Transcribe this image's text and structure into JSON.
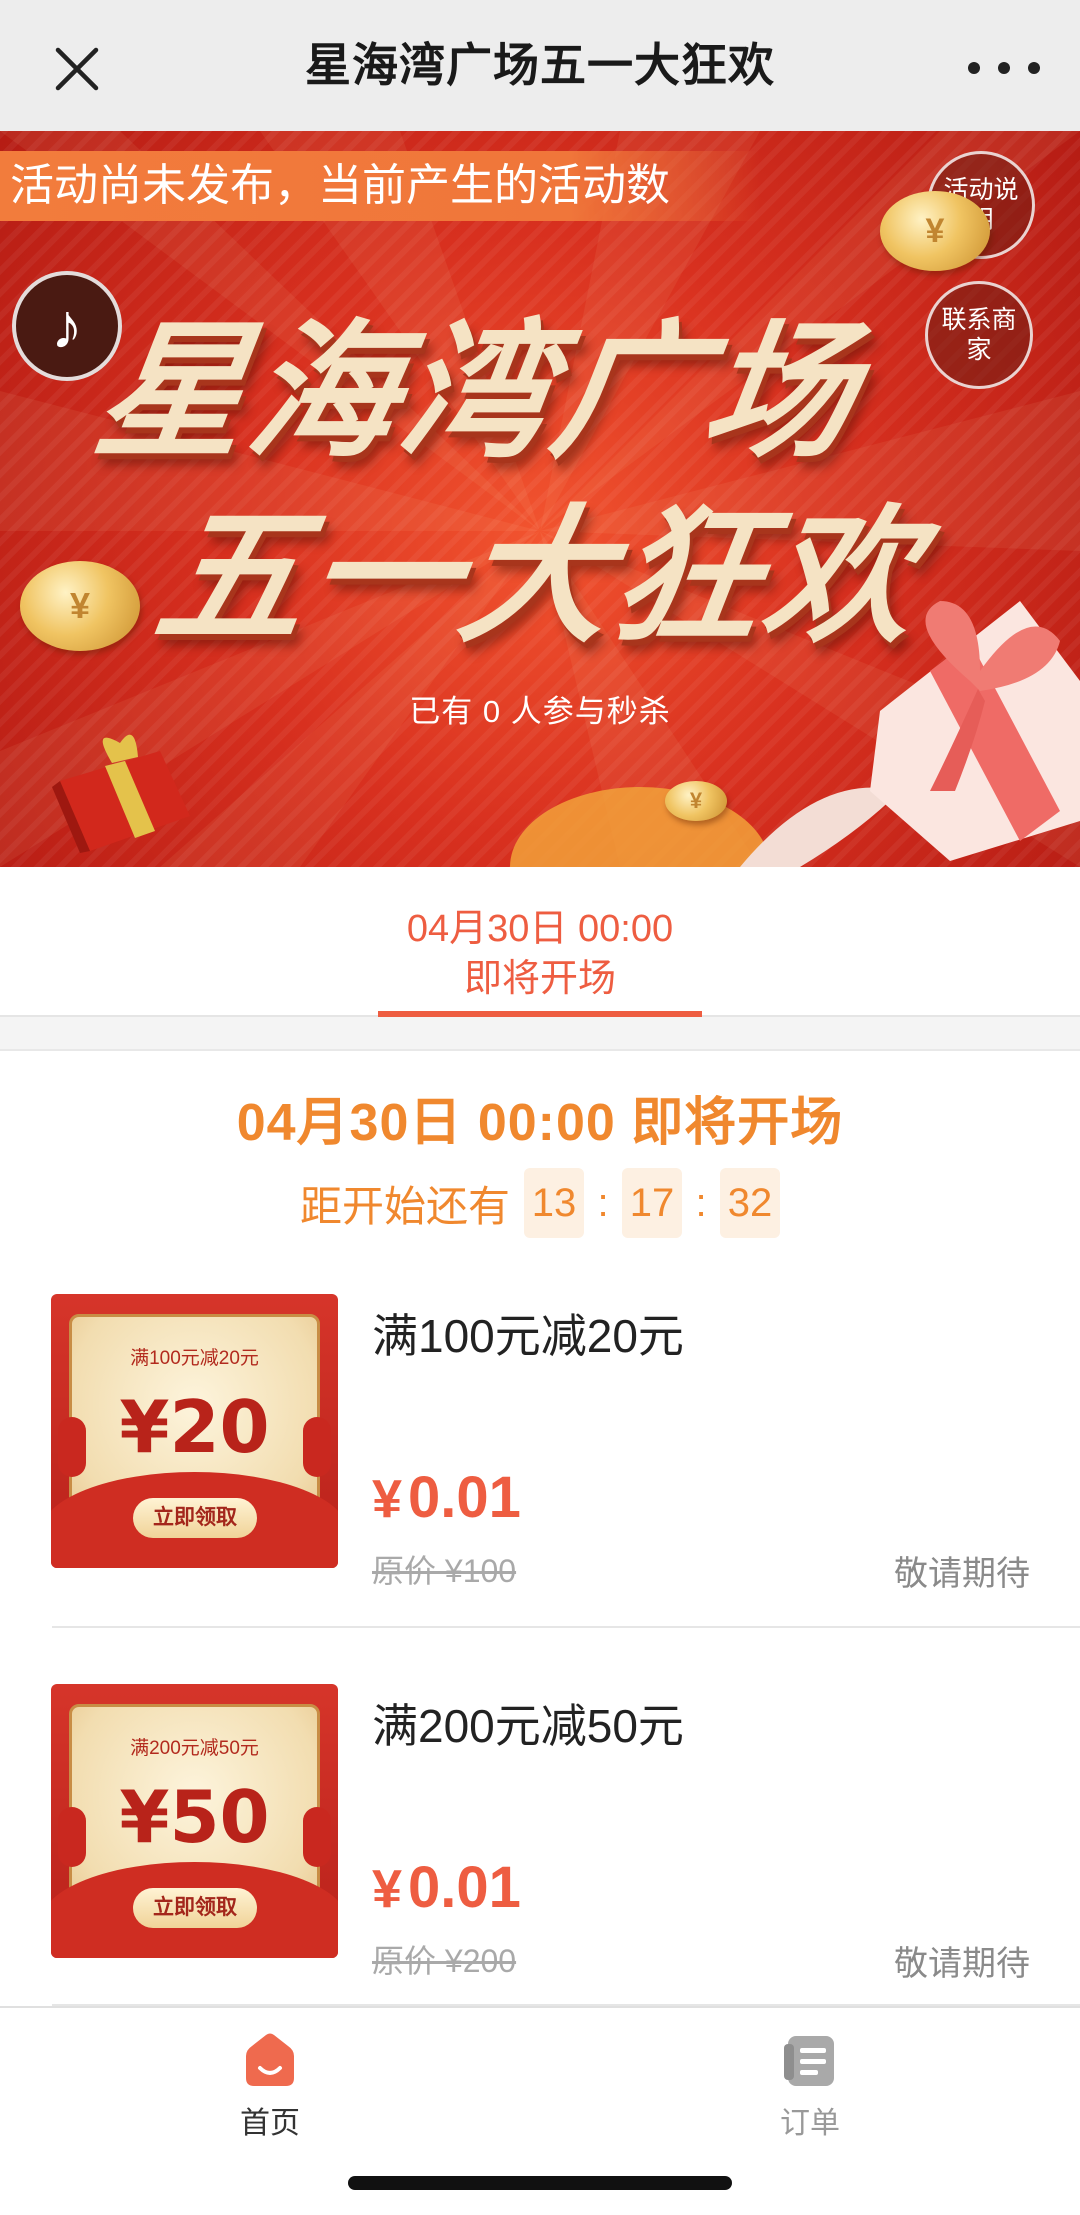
{
  "navbar": {
    "title": "星海湾广场五一大狂欢",
    "close_icon": "close-icon",
    "more_icon": "more-dots-icon"
  },
  "banner": {
    "notice": "活动尚未发布，当前产生的活动数",
    "desc_button": "活动说明",
    "contact_button": "联系商家",
    "music_icon": "music-note-icon",
    "hero_line1": "星海湾广场",
    "hero_line2": "五一大狂欢",
    "participants": "已有 0 人参与秒杀",
    "coin_symbol": "¥"
  },
  "session": {
    "time": "04月30日 00:00",
    "status": "即将开场"
  },
  "countdown": {
    "headline": "04月30日 00:00 即将开场",
    "label": "距开始还有",
    "hours": "13",
    "minutes": "17",
    "seconds": "32",
    "separator": ":"
  },
  "products": [
    {
      "name": "满100元减20元",
      "coupon_condition": "满100元减20元",
      "coupon_amount": "¥20",
      "coupon_button": "立即领取",
      "currency": "¥",
      "price": "0.01",
      "original_price": "原价 ¥100",
      "status": "敬请期待"
    },
    {
      "name": "满200元减50元",
      "coupon_condition": "满200元减50元",
      "coupon_amount": "¥50",
      "coupon_button": "立即领取",
      "currency": "¥",
      "price": "0.01",
      "original_price": "原价 ¥200",
      "status": "敬请期待"
    }
  ],
  "tabbar": {
    "home_label": "首页",
    "orders_label": "订单",
    "home_icon": "home-icon",
    "orders_icon": "orders-icon"
  },
  "colors": {
    "accent": "#ee5d41",
    "countdown": "#f0882e",
    "banner_red": "#d8301f",
    "gold": "#f5e3c4"
  }
}
